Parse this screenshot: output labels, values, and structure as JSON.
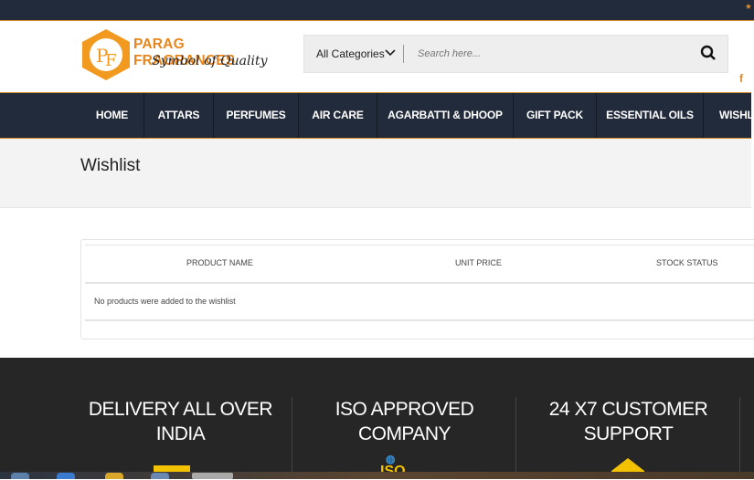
{
  "brand": {
    "name": "PARAG FRAGRANCES",
    "tagline": "Symbol of Quality",
    "logo_letters": "PF"
  },
  "search": {
    "category": "All Categories",
    "placeholder": "Search here..."
  },
  "social": {
    "facebook": "f"
  },
  "nav": [
    "HOME",
    "ATTARS",
    "PERFUMES",
    "AIR CARE",
    "AGARBATTI & DHOOP",
    "GIFT PACK",
    "ESSENTIAL OILS",
    "WISHL"
  ],
  "page": {
    "title": "Wishlist"
  },
  "table": {
    "headers": [
      "PRODUCT NAME",
      "UNIT PRICE",
      "STOCK STATUS"
    ],
    "empty_message": "No products were added to the wishlist"
  },
  "footer": {
    "features": [
      {
        "line1": "DELIVERY ALL OVER",
        "line2": "INDIA"
      },
      {
        "line1": "ISO APPROVED",
        "line2": "COMPANY"
      },
      {
        "line1": "24 X7 CUSTOMER",
        "line2": "SUPPORT"
      }
    ],
    "iso_badge": "ISO"
  },
  "colors": {
    "accent": "#e8861d",
    "nav": "#222b3b",
    "footer": "#262626"
  }
}
